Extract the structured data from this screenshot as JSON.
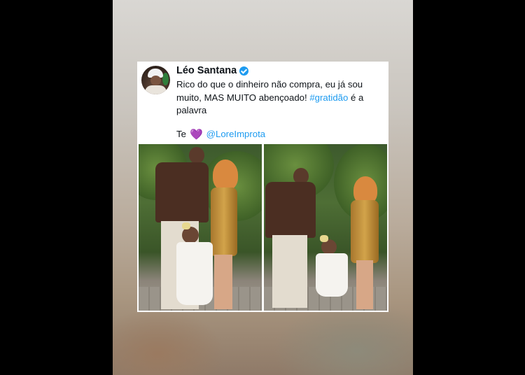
{
  "tweet": {
    "author_name": "Léo Santana",
    "verified": true,
    "text_part1": "Rico do que o dinheiro não compra, eu já sou muito, MAS MUITO abençoado! ",
    "hashtag": "#gratidão",
    "text_part2": " é a palavra",
    "sign_prefix": "Te",
    "sign_emoji": "💜",
    "mention": "@LoreImprota"
  },
  "colors": {
    "link": "#1d9bf0",
    "text": "#0f1419",
    "card_bg": "#ffffff",
    "page_bg": "#000000"
  },
  "icons": {
    "verified": "verified-badge-icon",
    "heart": "purple-heart-icon"
  },
  "photos": {
    "count": 2
  }
}
